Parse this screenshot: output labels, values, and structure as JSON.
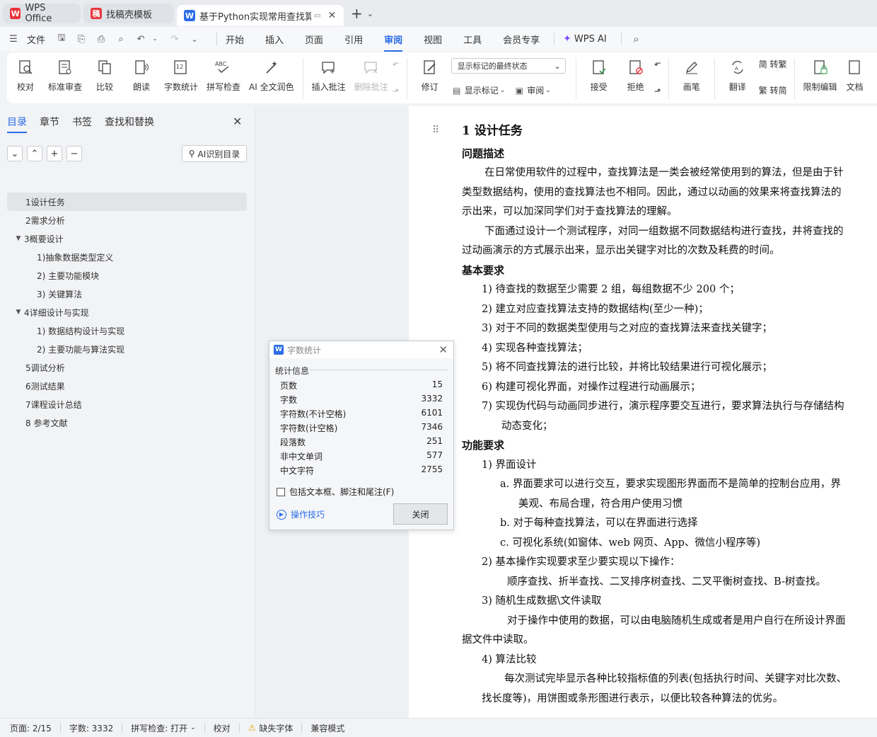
{
  "tabs": [
    {
      "label": "WPS Office",
      "logo": "W",
      "logo_color": "#e8353b"
    },
    {
      "label": "找稿壳模板",
      "logo": "稿",
      "logo_color": "#e8353b"
    },
    {
      "label": "基于Python实现常用查找算法",
      "logo": "W",
      "logo_color": "#2b6ce8"
    }
  ],
  "menu": {
    "file_label": "文件",
    "items": [
      "开始",
      "插入",
      "页面",
      "引用",
      "审阅",
      "视图",
      "工具",
      "会员专享"
    ],
    "active": "审阅",
    "wps_ai_label": "WPS AI"
  },
  "ribbon": {
    "proofread": "校对",
    "standard_review": "标准审查",
    "compare": "比较",
    "read_aloud": "朗读",
    "word_count": "字数统计",
    "spell_check": "拼写检查",
    "ai_polish": "AI 全文润色",
    "insert_comment": "插入批注",
    "delete_comment": "删除批注",
    "track_changes": "修订",
    "markup_select": "显示标记的最终状态",
    "show_markup": "显示标记",
    "review_pane": "审阅",
    "accept": "接受",
    "reject": "拒绝",
    "ink": "画笔",
    "translate": "翻译",
    "to_traditional": "简 转繁",
    "to_simplified": "繁 转简",
    "restrict_editing": "限制编辑",
    "doc_protect": "文档"
  },
  "nav": {
    "tabs": [
      "目录",
      "章节",
      "书签",
      "查找和替换"
    ],
    "ai_toc_label": "AI识别目录",
    "toc": [
      {
        "label": "1设计任务",
        "level": 1,
        "selected": true,
        "expandable": false
      },
      {
        "label": "2需求分析",
        "level": 1,
        "selected": false,
        "expandable": false
      },
      {
        "label": "3概要设计",
        "level": 1,
        "selected": false,
        "expandable": true
      },
      {
        "label": "1)抽象数据类型定义",
        "level": 2,
        "selected": false,
        "expandable": false
      },
      {
        "label": "2) 主要功能模块",
        "level": 2,
        "selected": false,
        "expandable": false
      },
      {
        "label": "3) 关键算法",
        "level": 2,
        "selected": false,
        "expandable": false
      },
      {
        "label": "4详细设计与实现",
        "level": 1,
        "selected": false,
        "expandable": true
      },
      {
        "label": "1) 数据结构设计与实现",
        "level": 2,
        "selected": false,
        "expandable": false
      },
      {
        "label": "2) 主要功能与算法实现",
        "level": 2,
        "selected": false,
        "expandable": false
      },
      {
        "label": "5调试分析",
        "level": 1,
        "selected": false,
        "expandable": false
      },
      {
        "label": "6测试结果",
        "level": 1,
        "selected": false,
        "expandable": false
      },
      {
        "label": "7课程设计总结",
        "level": 1,
        "selected": false,
        "expandable": false
      },
      {
        "label": "8 参考文献",
        "level": 1,
        "selected": false,
        "expandable": false
      }
    ]
  },
  "dialog": {
    "title": "字数统计",
    "group_label": "统计信息",
    "stats": [
      {
        "label": "页数",
        "value": "15"
      },
      {
        "label": "字数",
        "value": "3332"
      },
      {
        "label": "字符数(不计空格)",
        "value": "6101"
      },
      {
        "label": "字符数(计空格)",
        "value": "7346"
      },
      {
        "label": "段落数",
        "value": "251"
      },
      {
        "label": "非中文单词",
        "value": "577"
      },
      {
        "label": "中文字符",
        "value": "2755"
      }
    ],
    "checkbox_label": "包括文本框、脚注和尾注(F)",
    "tips_label": "操作技巧",
    "close_label": "关闭"
  },
  "doc": {
    "lines": [
      {
        "text": "1  设计任务",
        "cls": "h1",
        "indent": 0
      },
      {
        "text": "问题描述",
        "cls": "h2",
        "indent": 0
      },
      {
        "text": "在日常使用软件的过程中，查找算法是一类会被经常使用到的算法，但是由于针",
        "cls": "",
        "indent": 32
      },
      {
        "text": "类型数据结构，使用的查找算法也不相同。因此，通过以动画的效果来将查找算法的",
        "cls": "",
        "indent": 0
      },
      {
        "text": "示出来，可以加深同学们对于查找算法的理解。",
        "cls": "",
        "indent": 0
      },
      {
        "text": "下面通过设计一个测试程序，对同一组数据不同数据结构进行查找，并将查找的",
        "cls": "",
        "indent": 32
      },
      {
        "text": "过动画演示的方式展示出来，显示出关键字对比的次数及耗费的时间。",
        "cls": "",
        "indent": 0
      },
      {
        "text": "基本要求",
        "cls": "h2",
        "indent": 0
      },
      {
        "text": "1)   待查找的数据至少需要 2 组，每组数据不少 200 个；",
        "cls": "",
        "indent": 28
      },
      {
        "text": "2)   建立对应查找算法支持的数据结构(至少一种)；",
        "cls": "",
        "indent": 28
      },
      {
        "text": "3)   对于不同的数据类型使用与之对应的查找算法来查找关键字；",
        "cls": "",
        "indent": 28
      },
      {
        "text": "4)   实现各种查找算法；",
        "cls": "",
        "indent": 28
      },
      {
        "text": "5)   将不同查找算法的进行比较，并将比较结果进行可视化展示；",
        "cls": "",
        "indent": 28
      },
      {
        "text": "6)   构建可视化界面，对操作过程进行动画展示；",
        "cls": "",
        "indent": 28
      },
      {
        "text": "7)   实现伪代码与动画同步进行，演示程序要交互进行，要求算法执行与存储结构",
        "cls": "",
        "indent": 28
      },
      {
        "text": "动态变化；",
        "cls": "",
        "indent": 56
      },
      {
        "text": "功能要求",
        "cls": "h2",
        "indent": 0
      },
      {
        "text": "1)   界面设计",
        "cls": "",
        "indent": 28
      },
      {
        "text": "a.   界面要求可以进行交互，要求实现图形界面而不是简单的控制台应用，界",
        "cls": "",
        "indent": 54
      },
      {
        "text": "美观、布局合理，符合用户使用习惯",
        "cls": "",
        "indent": 80
      },
      {
        "text": "b.   对于每种查找算法，可以在界面进行选择",
        "cls": "",
        "indent": 54
      },
      {
        "text": "c.   可视化系统(如窗体、web 网页、App、微信小程序等)",
        "cls": "",
        "indent": 54
      },
      {
        "text": "2)   基本操作实现要求至少要实现以下操作：",
        "cls": "",
        "indent": 28
      },
      {
        "text": "顺序查找、折半查找、二叉排序树查找、二叉平衡树查找、B-树查找。",
        "cls": "",
        "indent": 64
      },
      {
        "text": "3)   随机生成数据\\文件读取",
        "cls": "",
        "indent": 28
      },
      {
        "text": "对于操作中使用的数据，可以由电脑随机生成或者是用户自行在所设计界面",
        "cls": "",
        "indent": 64
      },
      {
        "text": "据文件中读取。",
        "cls": "",
        "indent": 0
      },
      {
        "text": "4)   算法比较",
        "cls": "",
        "indent": 28
      },
      {
        "text": "每次测试完毕显示各种比较指标值的列表(包括执行时间、关键字对比次数、",
        "cls": "",
        "indent": 60
      },
      {
        "text": "找长度等)，用饼图或条形图进行表示，以便比较各种算法的优劣。",
        "cls": "",
        "indent": 28
      }
    ]
  },
  "status": {
    "page": "页面: 2/15",
    "words": "字数: 3332",
    "spell": "拼写检查: 打开",
    "proof": "校对",
    "missing_font": "缺失字体",
    "compat": "兼容模式"
  }
}
